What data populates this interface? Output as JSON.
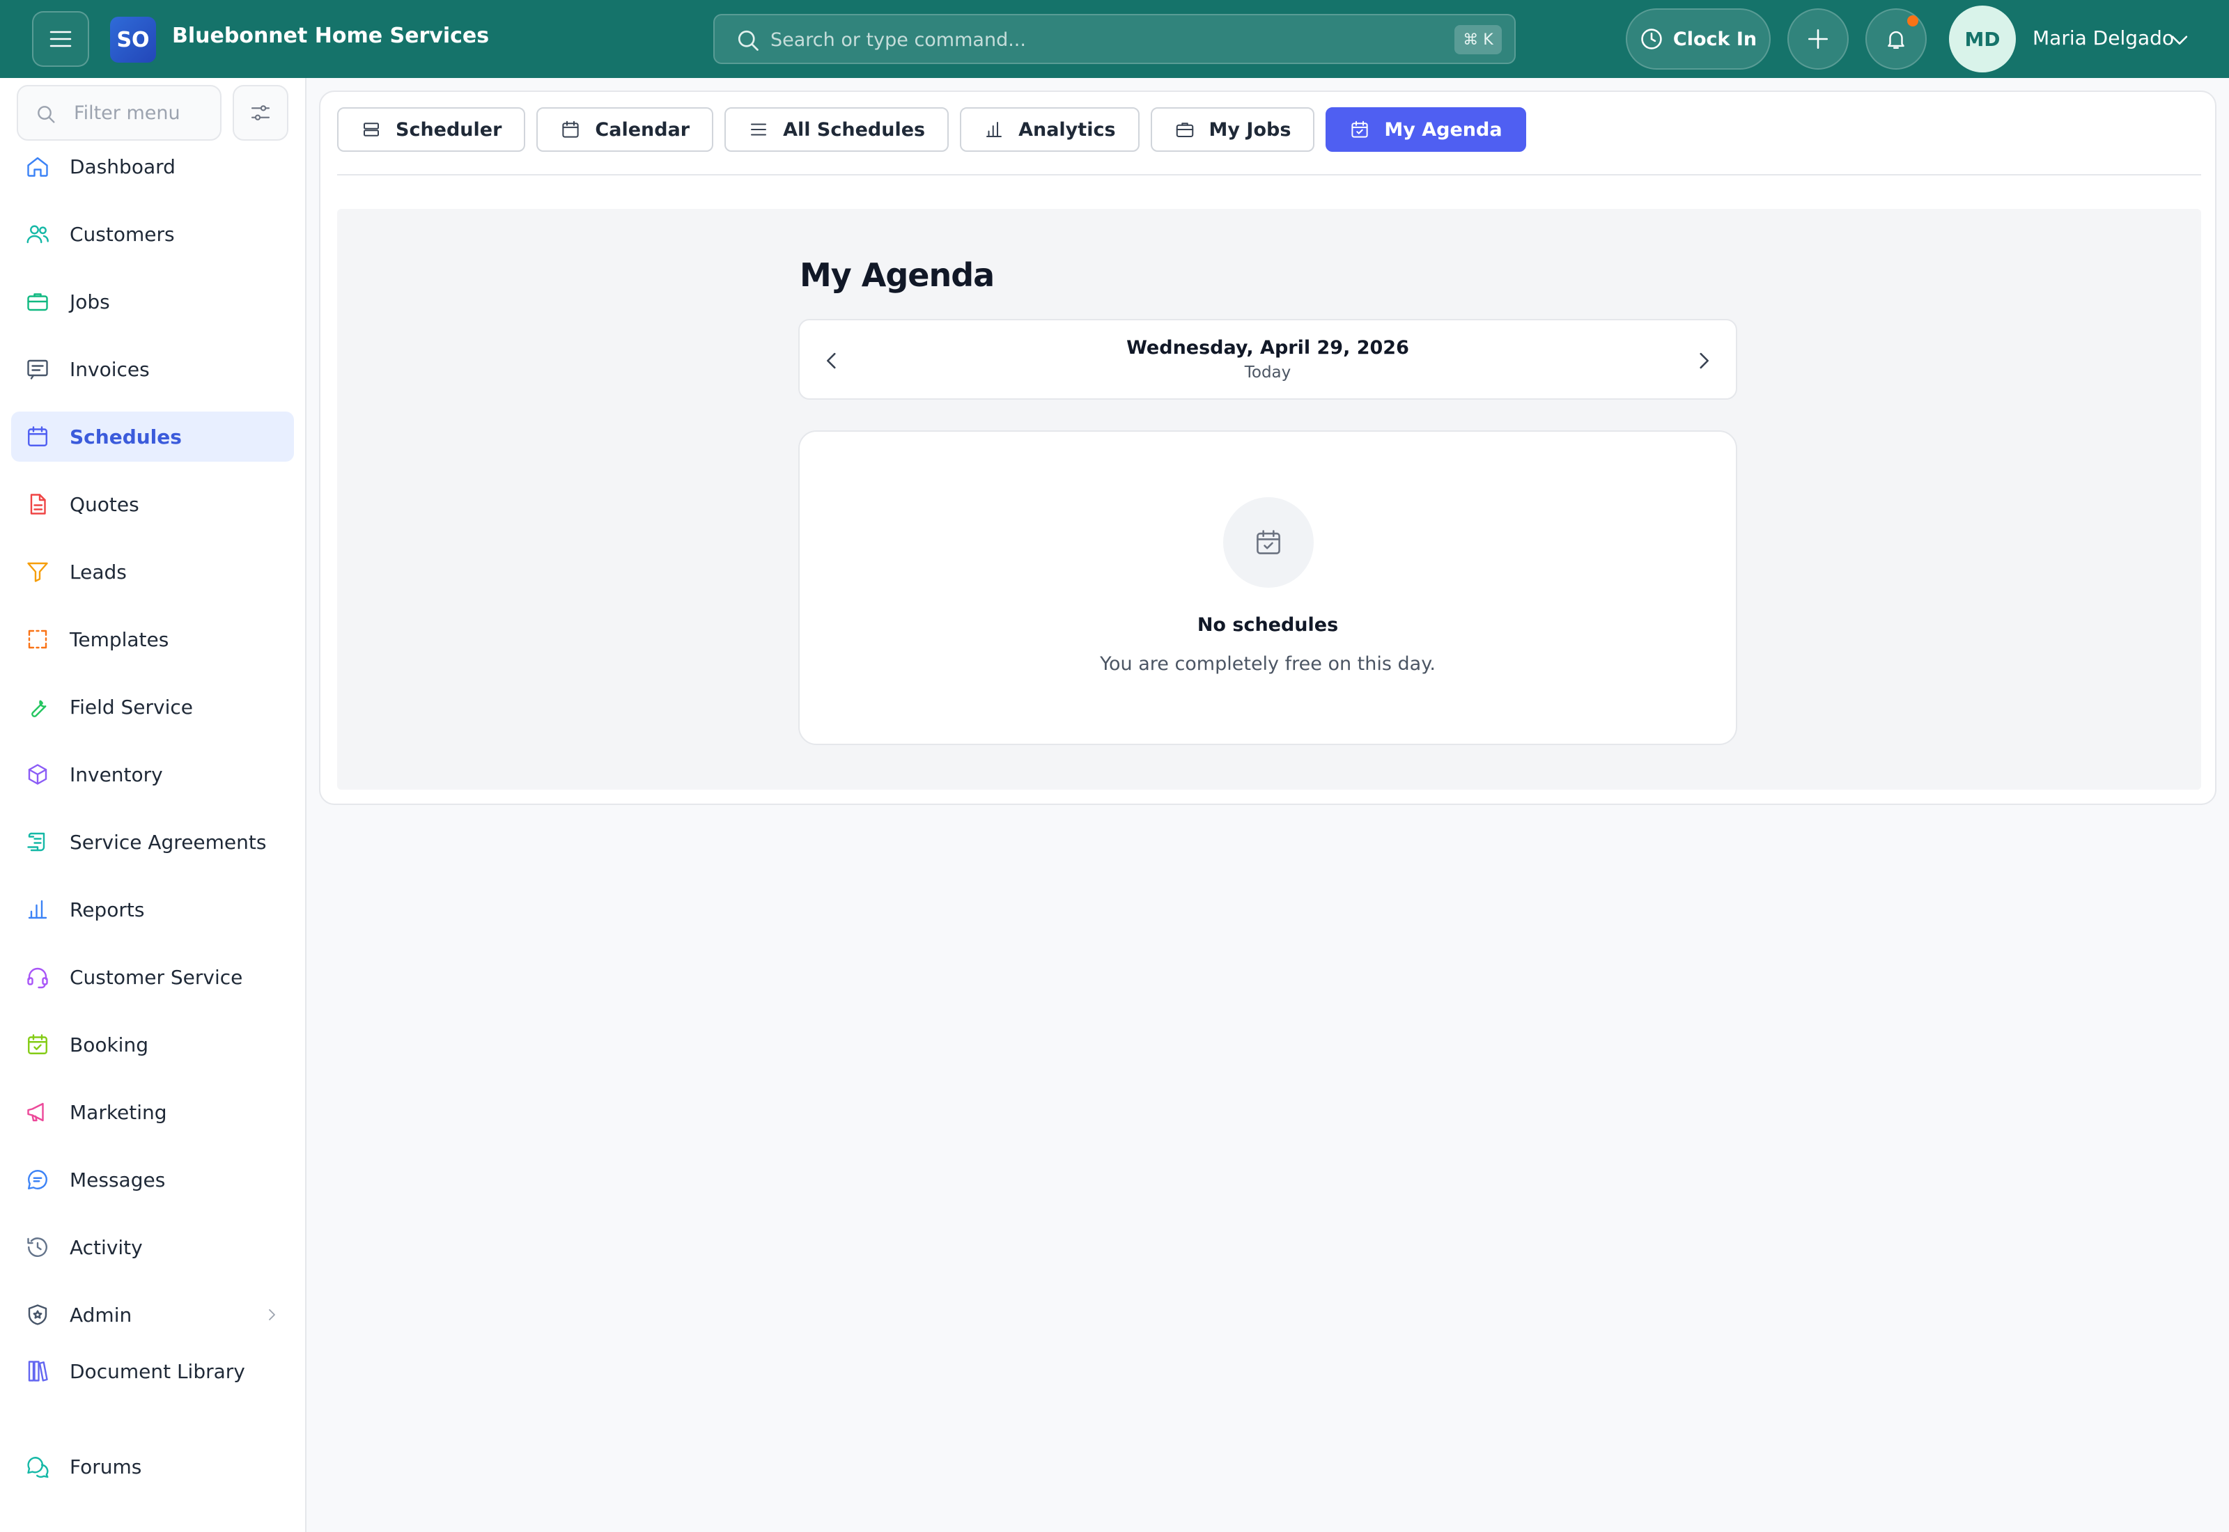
{
  "app": {
    "logo_text": "SO",
    "brand_name": "Bluebonnet Home Services"
  },
  "topbar": {
    "search_placeholder": "Search or type command...",
    "search_shortcut": "⌘ K",
    "clock_in_label": "Clock In",
    "has_notification": true,
    "user_initials": "MD",
    "user_name": "Maria Delgado"
  },
  "sidebar": {
    "filter_placeholder": "Filter menu",
    "items": [
      {
        "label": "Dashboard",
        "icon": "home-icon",
        "color": "#3b82f6"
      },
      {
        "label": "Customers",
        "icon": "users-icon",
        "color": "#14b8a6"
      },
      {
        "label": "Jobs",
        "icon": "briefcase-icon",
        "color": "#10b981"
      },
      {
        "label": "Invoices",
        "icon": "invoice-icon",
        "color": "#475569"
      },
      {
        "label": "Schedules",
        "icon": "calendar-icon",
        "color": "#4f5ff2",
        "active": true
      },
      {
        "label": "Quotes",
        "icon": "file-text-icon",
        "color": "#ef4444"
      },
      {
        "label": "Leads",
        "icon": "funnel-icon",
        "color": "#f59e0b"
      },
      {
        "label": "Templates",
        "icon": "template-icon",
        "color": "#f97316"
      },
      {
        "label": "Field Service",
        "icon": "wrench-icon",
        "color": "#22c55e"
      },
      {
        "label": "Inventory",
        "icon": "box-icon",
        "color": "#8b5cf6"
      },
      {
        "label": "Service Agreements",
        "icon": "scroll-icon",
        "color": "#14b8a6"
      },
      {
        "label": "Reports",
        "icon": "bar-chart-icon",
        "color": "#3b82f6"
      },
      {
        "label": "Customer Service",
        "icon": "headset-icon",
        "color": "#a855f7"
      },
      {
        "label": "Booking",
        "icon": "calendar-check-icon",
        "color": "#84cc16"
      },
      {
        "label": "Marketing",
        "icon": "megaphone-icon",
        "color": "#ec4899"
      },
      {
        "label": "Messages",
        "icon": "message-icon",
        "color": "#3b82f6"
      },
      {
        "label": "Activity",
        "icon": "history-icon",
        "color": "#64748b"
      },
      {
        "label": "Admin",
        "icon": "shield-icon",
        "color": "#475569",
        "expandable": true
      },
      {
        "label": "Document Library",
        "icon": "library-icon",
        "color": "#6366f1"
      },
      {
        "label": "Forums",
        "icon": "chat-bubbles-icon",
        "color": "#14b8a6"
      }
    ]
  },
  "tabs": [
    {
      "label": "Scheduler",
      "icon": "layers-icon"
    },
    {
      "label": "Calendar",
      "icon": "calendar-icon"
    },
    {
      "label": "All Schedules",
      "icon": "list-icon"
    },
    {
      "label": "Analytics",
      "icon": "bar-chart-icon"
    },
    {
      "label": "My Jobs",
      "icon": "briefcase-icon"
    },
    {
      "label": "My Agenda",
      "icon": "calendar-check-icon",
      "active": true
    }
  ],
  "agenda": {
    "title": "My Agenda",
    "date": "Wednesday, April 29, 2026",
    "relative": "Today",
    "empty_title": "No schedules",
    "empty_subtitle": "You are completely free on this day."
  },
  "colors": {
    "header": "#15736a",
    "accent": "#4f5ff2",
    "notification_dot": "#f97316"
  }
}
